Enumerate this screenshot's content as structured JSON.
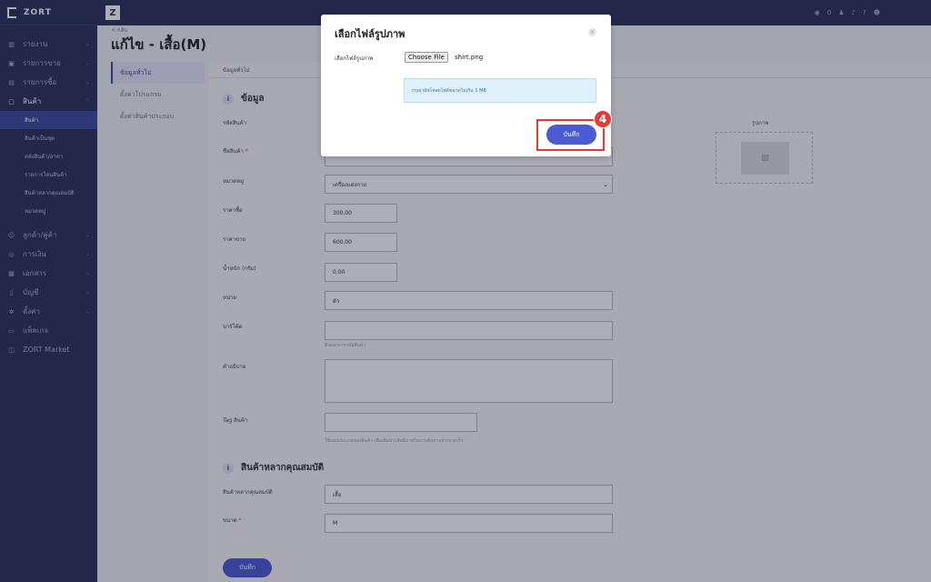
{
  "brand": "ZORT",
  "sidebar": {
    "items": [
      {
        "label": "รายงาน",
        "icon": "chart-icon"
      },
      {
        "label": "รายการขาย",
        "icon": "cart-icon"
      },
      {
        "label": "รายการซื้อ",
        "icon": "bag-icon"
      },
      {
        "label": "สินค้า",
        "icon": "box-icon"
      }
    ],
    "sub": [
      "สินค้า",
      "สินค้าเป็นชุด",
      "คลังสินค้า/สาขา",
      "รายการโอนสินค้า",
      "สินค้าหลากคุณสมบัติ",
      "หมวดหมู่"
    ],
    "items2": [
      {
        "label": "ลูกค้า/คู่ค้า",
        "icon": "users-icon"
      },
      {
        "label": "การเงิน",
        "icon": "money-icon"
      },
      {
        "label": "เอกสาร",
        "icon": "doc-icon"
      },
      {
        "label": "บัญชี",
        "icon": "ledger-icon"
      },
      {
        "label": "ตั้งค่า",
        "icon": "gear-icon"
      },
      {
        "label": "แพ็คเกจ",
        "icon": "package-icon"
      },
      {
        "label": "ZORT Market",
        "icon": "market-icon"
      }
    ]
  },
  "topbar": {
    "coins": "0"
  },
  "page": {
    "back": "< กลับ",
    "title": "แก้ไข - เสื้อ(M)",
    "tabs": [
      "ข้อมูลทั่วไป",
      "ตั้งค่าโปรแกรม",
      "ตั้งค่าสินค้าประกอบ"
    ],
    "panel_head": "ข้อมูลทั่วไป"
  },
  "form": {
    "section1": "ข้อมูล",
    "section2": "สินค้าหลากคุณสมบัติ",
    "sku_label": "รหัสสินค้า",
    "name_label": "ชื่อสินค้า",
    "category_label": "หมวดหมู่",
    "category_value": "เครื่องแต่งกาย",
    "buy_label": "ราคาซื้อ",
    "buy_value": "300.00",
    "sell_label": "ราคาขาย",
    "sell_value": "600.00",
    "weight_label": "น้ำหนัก (กรัม)",
    "weight_value": "0.00",
    "unit_label": "หน่วย",
    "unit_value": "ตัว",
    "barcode_label": "บาร์โค้ด",
    "barcode_help": "ดึงออกจากรหัสสินค้า",
    "desc_label": "คำอธิบาย",
    "tag_label": "Tag สินค้า",
    "tag_help": "ใช้แบ่งประเภทของสินค้า เพื่อเพิ่มประสิทธิภาพในการค้นหาอย่างรวดเร็ว",
    "variant_label": "สินค้าหลากคุณสมบัติ",
    "variant_value": "เสื้อ",
    "size_label": "ขนาด",
    "size_value": "M",
    "image_label": "รูปภาพ",
    "save": "บันทึก"
  },
  "modal": {
    "title": "เลือกไฟล์รูปภาพ",
    "label": "เลือกไฟล์รูปภาพ",
    "choose": "Choose File",
    "filename": "shirt.png",
    "info": "กรุณาอัพโหลดไฟล์ขนาดไม่เกิน 1 MB",
    "save": "บันทึก",
    "close": "×"
  },
  "annotation": {
    "step": "4",
    "color": "#e53935"
  }
}
